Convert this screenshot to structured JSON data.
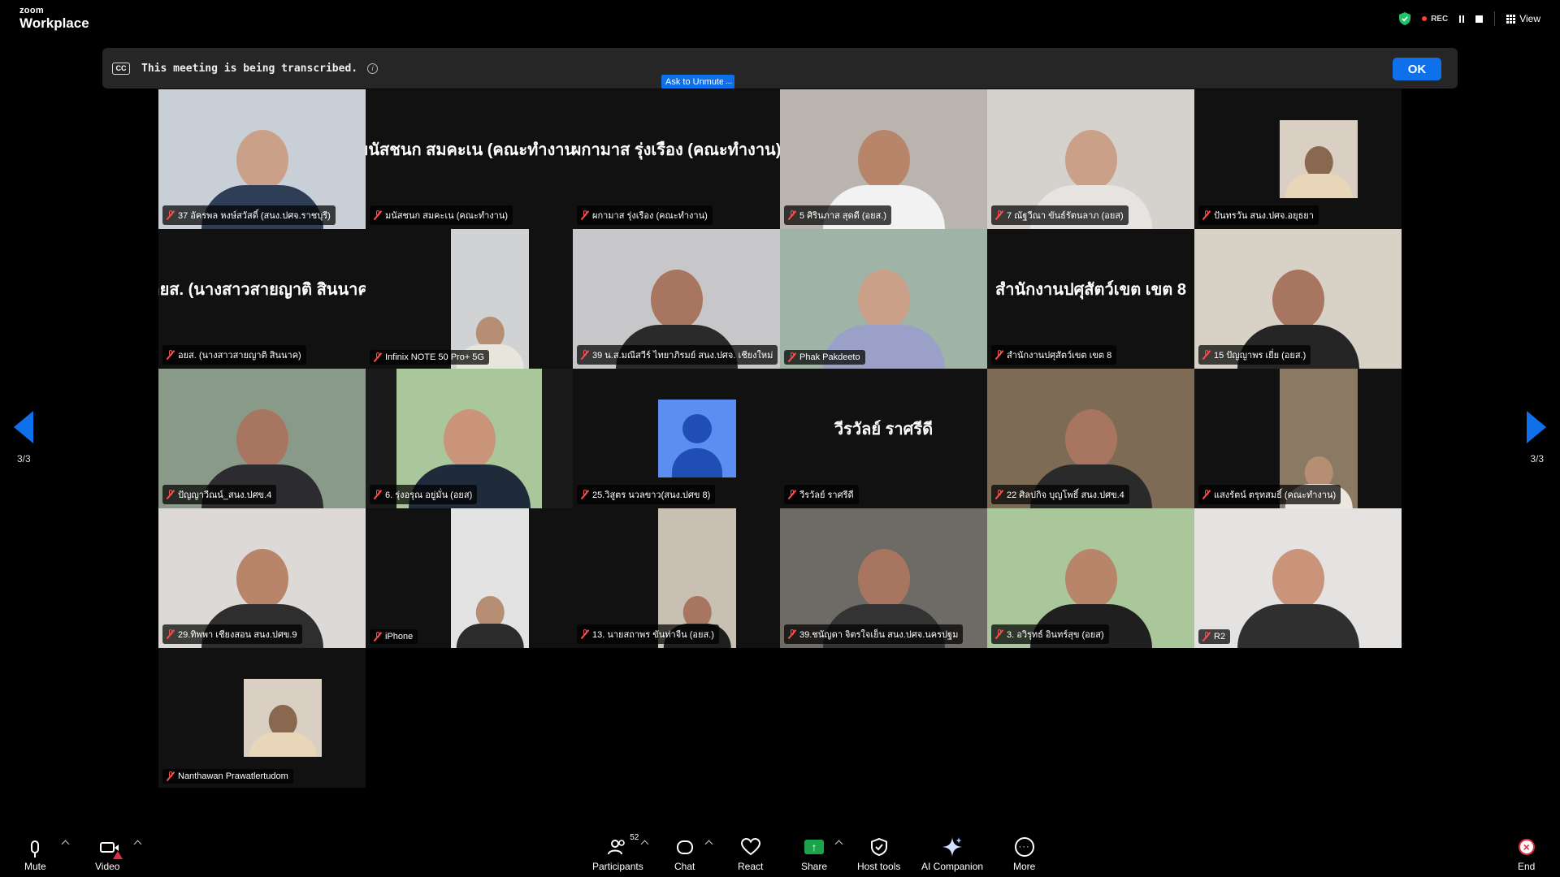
{
  "app": {
    "brand_top": "zoom",
    "brand_bottom": "Workplace"
  },
  "topbar": {
    "rec_label": "REC",
    "view_label": "View"
  },
  "banner": {
    "cc_label": "CC",
    "text": "This meeting is being transcribed.",
    "ok_label": "OK"
  },
  "ask_unmute": {
    "label": "Ask to Unmute",
    "more_label": "..."
  },
  "pagination": {
    "left": "3/3",
    "right": "3/3"
  },
  "tiles": [
    {
      "label": "37 อัครพล หงษ์สวัสดิ์ (สนง.ปศจ.ราชบุรี)",
      "name_display": "",
      "kind": "video",
      "bg": "#c9cfd6",
      "shirt": "#2f3e57",
      "skin": "#caa089"
    },
    {
      "label": "มนัสชนก สมคะเน (คณะทำงาน)",
      "name_display": "มนัสชนก สมคะเน (คณะทำงาน)",
      "kind": "name"
    },
    {
      "label": "ผกามาส รุ่งเรือง (คณะทำงาน)",
      "name_display": "ผกามาส รุ่งเรือง (คณะทำงาน)",
      "kind": "name"
    },
    {
      "label": "5 ศิรินภาส สุดดี (อยส.)",
      "name_display": "",
      "kind": "video",
      "bg": "#b9b5ae",
      "shirt": "#f2f2f2",
      "skin": "#b8856a"
    },
    {
      "label": "7 ณัฐวีณา ขันธ์รัตนลาภ (อยส)",
      "name_display": "",
      "kind": "video",
      "bg": "#d5d1cd",
      "shirt": "#e6e3e0",
      "skin": "#caa089"
    },
    {
      "label": "ปันทรวัน สนง.ปศจ.อยุธยา",
      "name_display": "",
      "kind": "small",
      "bg": "#d9cfc2",
      "shirt": "#e9d6b8",
      "skin": "#8a6850"
    },
    {
      "label": "อยส. (นางสาวสายญาติ สินนาค)",
      "name_display": "อยส. (นางสาวสายญาติ สินนาค)",
      "kind": "name"
    },
    {
      "label": "Infinix NOTE 50 Pro+ 5G",
      "name_display": "",
      "kind": "small",
      "bg": "#d0d2d4",
      "shirt": "#e8e6dc",
      "skin": "#b58e74"
    },
    {
      "label": "39 น.ส.มณีสวีร์ ไทยาภิรมย์ สนง.ปศจ. เชียงใหม่",
      "name_display": "",
      "kind": "video",
      "bg": "#c7c7c9",
      "shirt": "#2a2a2a",
      "skin": "#a87660"
    },
    {
      "label": "Phak Pakdeeto",
      "name_display": "",
      "kind": "video",
      "bg": "#9fb3a6",
      "shirt": "#9aa0c7",
      "skin": "#caa089"
    },
    {
      "label": "สำนักงานปศุสัตว์เขต เขต 8",
      "name_display": "สำนักงานปศุสัตว์เขต เขต 8",
      "kind": "name"
    },
    {
      "label": "15 ปัญญาพร เยี่ย (อยส.)",
      "name_display": "",
      "kind": "video",
      "bg": "#d8d2c6",
      "shirt": "#252525",
      "skin": "#a87660"
    },
    {
      "label": "ปัญญาวีณน์_สนง.ปศข.4",
      "name_display": "",
      "kind": "video",
      "bg": "#8a9a88",
      "shirt": "#2c2c30",
      "skin": "#a87660"
    },
    {
      "label": "6. รุ่งอรุณ อยู่มั่น (อยส)",
      "name_display": "",
      "kind": "small_wide",
      "bg": "#a9c79a",
      "shirt": "#1f2a3a",
      "skin": "#c9947a"
    },
    {
      "label": "25.วิสูตร นวลขาว(สนง.ปศข 8)",
      "name_display": "",
      "kind": "avatar"
    },
    {
      "label": "วีรวัลย์ ราศรีดี",
      "name_display": "วีรวัลย์ ราศรีดี",
      "kind": "name"
    },
    {
      "label": "22 ศิลปกิจ บุญโพธิ์ สนง.ปศข.4",
      "name_display": "",
      "kind": "video",
      "bg": "#7d6b55",
      "shirt": "#2a2a2a",
      "skin": "#a87660"
    },
    {
      "label": "แสงรัตน์ ตรุทสมธิ์ (คณะทำงาน)",
      "name_display": "",
      "kind": "small",
      "bg": "#8a7a63",
      "shirt": "#ece6df",
      "skin": "#b58e74"
    },
    {
      "label": "29.ทิพพา เชียงสอน สนง.ปศข.9",
      "name_display": "",
      "kind": "video",
      "bg": "#dcd9d6",
      "shirt": "#2e2e2e",
      "skin": "#b8856a"
    },
    {
      "label": "iPhone",
      "name_display": "",
      "kind": "small",
      "bg": "#e3e3e3",
      "shirt": "#2b2b2b",
      "skin": "#b58e74"
    },
    {
      "label": "13. นายสถาพร ขันท่าจีน (อยส.)",
      "name_display": "",
      "kind": "small",
      "bg": "#c8c0b2",
      "shirt": "#1e1e1e",
      "skin": "#a87660"
    },
    {
      "label": "39.ชนัญดา จิตรใจเย็น สนง.ปศจ.นครปฐม",
      "name_display": "",
      "kind": "video",
      "bg": "#6e6a66",
      "shirt": "#333",
      "skin": "#a87660"
    },
    {
      "label": "3. อวิรุทธ์ อินทร์สุข (อยส)",
      "name_display": "",
      "kind": "video",
      "bg": "#a9c79a",
      "shirt": "#1f1f1f",
      "skin": "#b8856a"
    },
    {
      "label": "R2",
      "name_display": "",
      "kind": "video",
      "bg": "#e5e3e1",
      "shirt": "#2f2f2f",
      "skin": "#c9947a"
    },
    {
      "label": "Nanthawan Prawatlertudom",
      "name_display": "",
      "kind": "small",
      "bg": "#d9cfc2",
      "shirt": "#e9d6b8",
      "skin": "#8a6850"
    }
  ],
  "toolbar": {
    "mute": "Mute",
    "video": "Video",
    "participants": "Participants",
    "participants_count": "52",
    "chat": "Chat",
    "react": "React",
    "share": "Share",
    "host_tools": "Host tools",
    "ai_companion": "AI Companion",
    "more": "More",
    "end": "End"
  }
}
